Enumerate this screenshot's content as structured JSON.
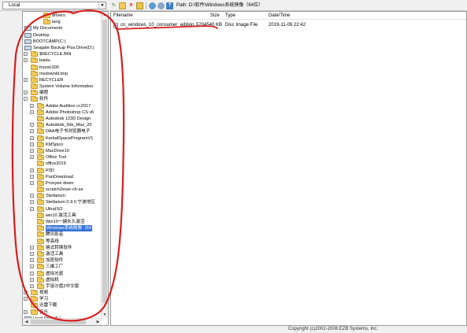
{
  "toolbar": {
    "local_label": "Local",
    "path_label": "Path:",
    "path_value": "D:\\软件\\Windows系统映像（64位）",
    "icons": [
      "refresh-icon",
      "new-folder-icon",
      "delete-icon",
      "rename-icon",
      "properties-icon",
      "settings-icon",
      "help-icon"
    ]
  },
  "tree": {
    "items": [
      {
        "label": "drivers",
        "depth": 3,
        "expander": "",
        "icon": "folder"
      },
      {
        "label": "lang",
        "depth": 3,
        "expander": "",
        "icon": "folder"
      },
      {
        "label": "My Documents",
        "depth": 0,
        "expander": "+",
        "icon": "drive"
      },
      {
        "label": "Desktop",
        "depth": 0,
        "expander": "+",
        "icon": "drive"
      },
      {
        "label": "BOOTCAMP(C:)",
        "depth": 0,
        "expander": "+",
        "icon": "drive"
      },
      {
        "label": "Seagate Backup Plus Drive(D:)",
        "depth": 0,
        "expander": "-",
        "icon": "drive"
      },
      {
        "label": "$RECYCLE.BIN",
        "depth": 1,
        "expander": "+",
        "icon": "folder"
      },
      {
        "label": "baidu",
        "depth": 1,
        "expander": "+",
        "icon": "folder"
      },
      {
        "label": "found.000",
        "depth": 1,
        "expander": "",
        "icon": "folder"
      },
      {
        "label": "msdownld.tmp",
        "depth": 1,
        "expander": "",
        "icon": "folder"
      },
      {
        "label": "RECYCLER",
        "depth": 1,
        "expander": "+",
        "icon": "folder"
      },
      {
        "label": "System Volume Information",
        "depth": 1,
        "expander": "",
        "icon": "folder"
      },
      {
        "label": "编程",
        "depth": 1,
        "expander": "+",
        "icon": "folder"
      },
      {
        "label": "软件",
        "depth": 1,
        "expander": "-",
        "icon": "folder"
      },
      {
        "label": "Adobe Audition cc2017",
        "depth": 2,
        "expander": "+",
        "icon": "folder"
      },
      {
        "label": "Adobe Photoshop CS v6",
        "depth": 2,
        "expander": "+",
        "icon": "folder"
      },
      {
        "label": "Autodesk 123D Design",
        "depth": 2,
        "expander": "",
        "icon": "folder"
      },
      {
        "label": "Autodesk_3ds_Max_20",
        "depth": 2,
        "expander": "+",
        "icon": "folder"
      },
      {
        "label": "DAA电子书浏览器电子",
        "depth": 2,
        "expander": "+",
        "icon": "folder"
      },
      {
        "label": "KerbalSpaceProgramV1",
        "depth": 2,
        "expander": "+",
        "icon": "folder"
      },
      {
        "label": "KMSpico",
        "depth": 2,
        "expander": "+",
        "icon": "folder"
      },
      {
        "label": "MacDrive10",
        "depth": 2,
        "expander": "+",
        "icon": "folder"
      },
      {
        "label": "Office Tool",
        "depth": 2,
        "expander": "+",
        "icon": "folder"
      },
      {
        "label": "office2019",
        "depth": 2,
        "expander": "",
        "icon": "folder"
      },
      {
        "label": "P3D",
        "depth": 2,
        "expander": "+",
        "icon": "folder"
      },
      {
        "label": "PanDownload",
        "depth": 2,
        "expander": "+",
        "icon": "folder"
      },
      {
        "label": "Proxyee down",
        "depth": 2,
        "expander": "+",
        "icon": "folder"
      },
      {
        "label": "scratch2exer-ch-se",
        "depth": 2,
        "expander": "",
        "icon": "folder"
      },
      {
        "label": "Stellarium",
        "depth": 2,
        "expander": "+",
        "icon": "folder"
      },
      {
        "label": "Stellarium 0.9.0 宁波地区",
        "depth": 2,
        "expander": "+",
        "icon": "folder"
      },
      {
        "label": "UltraISO",
        "depth": 2,
        "expander": "+",
        "icon": "folder"
      },
      {
        "label": "win10 激活工具",
        "depth": 2,
        "expander": "",
        "icon": "folder"
      },
      {
        "label": "Win10一键永久激活",
        "depth": 2,
        "expander": "",
        "icon": "folder"
      },
      {
        "label": "Windows系统映像（64",
        "depth": 2,
        "expander": "",
        "icon": "folder",
        "selected": true
      },
      {
        "label": "腾讯影音",
        "depth": 2,
        "expander": "",
        "icon": "folder"
      },
      {
        "label": "等高线",
        "depth": 2,
        "expander": "",
        "icon": "folder"
      },
      {
        "label": "格式转换软件",
        "depth": 2,
        "expander": "+",
        "icon": "folder"
      },
      {
        "label": "激活工具",
        "depth": 2,
        "expander": "+",
        "icon": "folder"
      },
      {
        "label": "加密软件",
        "depth": 2,
        "expander": "+",
        "icon": "folder"
      },
      {
        "label": "三维工厂",
        "depth": 2,
        "expander": "+",
        "icon": "folder"
      },
      {
        "label": "虚拟光驱",
        "depth": 2,
        "expander": "+",
        "icon": "folder"
      },
      {
        "label": "虚拟机",
        "depth": 2,
        "expander": "+",
        "icon": "folder"
      },
      {
        "label": "宇宙沙盘2中文版",
        "depth": 2,
        "expander": "+",
        "icon": "folder"
      },
      {
        "label": "视频",
        "depth": 1,
        "expander": "+",
        "icon": "folder"
      },
      {
        "label": "学习",
        "depth": 1,
        "expander": "+",
        "icon": "folder"
      },
      {
        "label": "迅雷下载",
        "depth": 1,
        "expander": "",
        "icon": "folder"
      },
      {
        "label": "音乐",
        "depth": 1,
        "expander": "+",
        "icon": "folder"
      },
      {
        "label": "Hard Drive(F:)",
        "depth": 0,
        "expander": "+",
        "icon": "drive"
      }
    ]
  },
  "files": {
    "columns": [
      "Filename",
      "Size",
      "Type",
      "Date/Time"
    ],
    "rows": [
      {
        "name": "cn_windows_10_consumer_edition...",
        "size": "5204540 KB",
        "type": "Disc Image File",
        "date": "2019-11-09 22:42"
      }
    ]
  },
  "status": {
    "copyright": "Copyright (c)2002-2008 EZB Systems, Inc."
  },
  "colors": {
    "selection": "#3875d7",
    "annotation": "#d91f1f",
    "folder": "#f1cb5a"
  }
}
